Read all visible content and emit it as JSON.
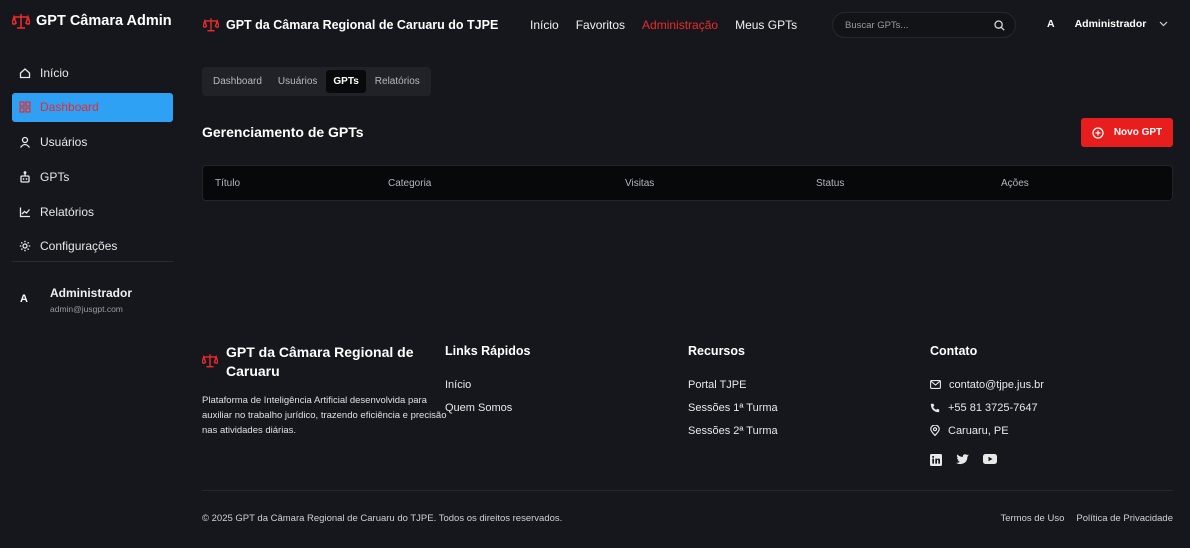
{
  "sidebar": {
    "brand": "GPT Câmara Admin",
    "items": [
      {
        "label": "Início",
        "icon": "home-icon"
      },
      {
        "label": "Dashboard",
        "icon": "dashboard-icon",
        "active": true
      },
      {
        "label": "Usuários",
        "icon": "user-icon"
      },
      {
        "label": "GPTs",
        "icon": "robot-icon"
      },
      {
        "label": "Relatórios",
        "icon": "chart-icon"
      },
      {
        "label": "Configurações",
        "icon": "gear-icon"
      }
    ],
    "user": {
      "avatar": "A",
      "name": "Administrador",
      "email": "admin@jusgpt.com"
    }
  },
  "header": {
    "title": "GPT da Câmara Regional de Caruaru do TJPE",
    "nav": [
      "Início",
      "Favoritos",
      "Administração",
      "Meus GPTs"
    ],
    "active_nav": "Administração",
    "search_placeholder": "Buscar GPTs...",
    "user_avatar": "A",
    "user_name": "Administrador"
  },
  "tabs": [
    "Dashboard",
    "Usuários",
    "GPTs",
    "Relatórios"
  ],
  "active_tab": "GPTs",
  "main": {
    "title": "Gerenciamento de GPTs",
    "new_button": "Novo GPT",
    "table_headers": [
      "Título",
      "Categoria",
      "Visitas",
      "Status",
      "Ações"
    ]
  },
  "footer": {
    "brand_title": "GPT da Câmara Regional de Caruaru",
    "description": "Plataforma de Inteligência Artificial desenvolvida para auxiliar no trabalho jurídico, trazendo eficiência e precisão nas atividades diárias.",
    "quick_links": {
      "title": "Links Rápidos",
      "items": [
        "Início",
        "Quem Somos"
      ]
    },
    "resources": {
      "title": "Recursos",
      "items": [
        "Portal TJPE",
        "Sessões 1ª Turma",
        "Sessões 2ª Turma"
      ]
    },
    "contact": {
      "title": "Contato",
      "email": "contato@tjpe.jus.br",
      "phone": "+55 81 3725-7647",
      "location": "Caruaru, PE"
    },
    "copyright": "© 2025 GPT da Câmara Regional de Caruaru do TJPE. Todos os direitos reservados.",
    "legal": [
      "Termos de Uso",
      "Política de Privacidade"
    ]
  },
  "colors": {
    "accent": "#e81e1e",
    "active_bg": "#2fa1f5",
    "background": "#16171c"
  }
}
